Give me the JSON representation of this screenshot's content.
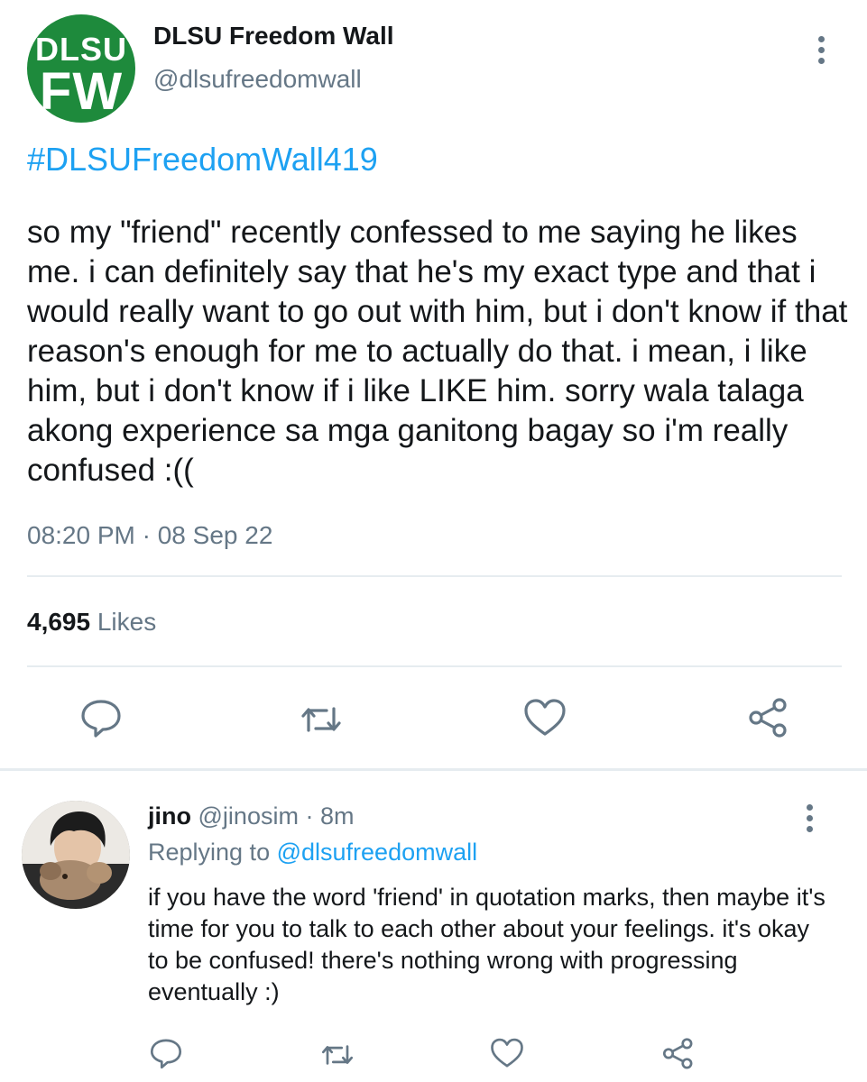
{
  "author": {
    "logo_line1": "DLSU",
    "logo_line2": "FW",
    "display_name": "DLSU Freedom Wall",
    "handle": "@dlsufreedomwall"
  },
  "tweet": {
    "hashtag": "#DLSUFreedomWall419",
    "text": "so my \"friend\" recently confessed to me saying he likes me. i can definitely say that he's my exact type and that i would really want to go out with him, but i don't know if that reason's enough for me to actually do that. i mean, i like him, but i don't know if i like LIKE him. sorry wala talaga akong experience sa mga ganitong bagay so i'm really confused :((",
    "timestamp": "08:20 PM · 08 Sep 22",
    "likes_count": "4,695",
    "likes_label": "Likes"
  },
  "icons": {
    "reply": "reply-icon",
    "retweet": "retweet-icon",
    "like": "heart-icon",
    "share": "share-icon",
    "more": "more-vertical-icon"
  },
  "colors": {
    "brand_green": "#1e8a3c",
    "link_blue": "#1da1f2",
    "secondary_text": "#657786",
    "divider": "#e6ecf0"
  },
  "reply": {
    "name": "jino",
    "handle": "@jinosim",
    "separator": "·",
    "time": "8m",
    "replying_prefix": "Replying to",
    "replying_to": "@dlsufreedomwall",
    "text": "if you have the word 'friend' in quotation marks, then maybe it's time for you to talk to each other about your feelings. it's okay to be confused! there's nothing wrong with progressing eventually :)"
  }
}
